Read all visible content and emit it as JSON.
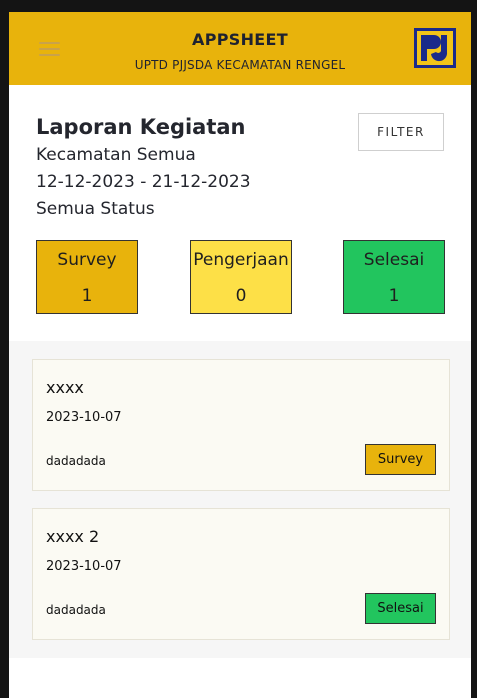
{
  "header": {
    "title": "APPSHEET",
    "subtitle": "UPTD PJJSDA KECAMATAN RENGEL",
    "menu_icon": "hamburger-menu-icon",
    "logo_icon": "pu-logo-icon"
  },
  "summary": {
    "title": "Laporan Kegiatan",
    "district": "Kecamatan Semua",
    "date_range": "12-12-2023 - 21-12-2023",
    "status": "Semua Status",
    "filter_label": "FILTER",
    "stats": [
      {
        "label": "Survey",
        "count": "1",
        "color": "#e8b30c"
      },
      {
        "label": "Pengerjaan",
        "count": "0",
        "color": "#fde047"
      },
      {
        "label": "Selesai",
        "count": "1",
        "color": "#22c55e"
      }
    ]
  },
  "reports": [
    {
      "name": "xxxx",
      "date": "2023-10-07",
      "description": "dadadada",
      "status": "Survey",
      "status_color": "#e8b30c"
    },
    {
      "name": "xxxx 2",
      "date": "2023-10-07",
      "description": "dadadada",
      "status": "Selesai",
      "status_color": "#22c55e"
    }
  ]
}
